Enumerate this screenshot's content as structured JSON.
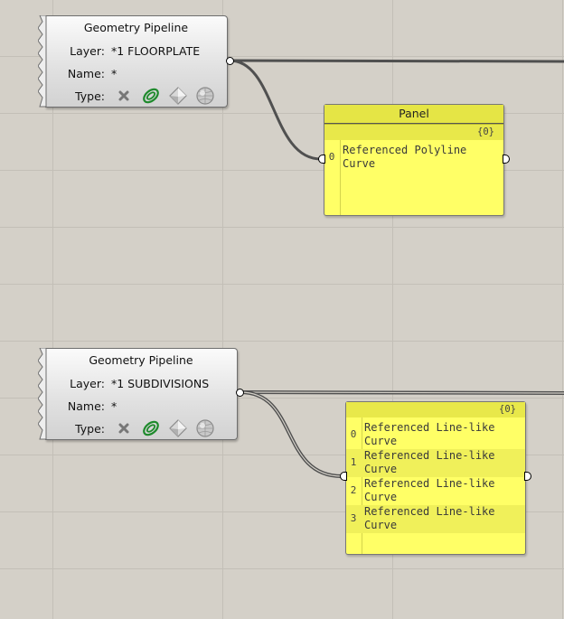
{
  "node1": {
    "title": "Geometry Pipeline",
    "layer_label": "Layer:",
    "layer_value": "*1 FLOORPLATE",
    "name_label": "Name:",
    "name_value": "*",
    "type_label": "Type:"
  },
  "panel1": {
    "title": "Panel",
    "branch": "{0}",
    "items": [
      {
        "index": "0",
        "line1": "Referenced Polyline",
        "line2": "Curve"
      }
    ]
  },
  "node2": {
    "title": "Geometry Pipeline",
    "layer_label": "Layer:",
    "layer_value": "*1 SUBDIVISIONS",
    "name_label": "Name:",
    "name_value": "*",
    "type_label": "Type:"
  },
  "panel2": {
    "branch": "{0}",
    "items": [
      {
        "index": "0",
        "line1": "Referenced Line-like",
        "line2": "Curve"
      },
      {
        "index": "1",
        "line1": "Referenced Line-like",
        "line2": "Curve"
      },
      {
        "index": "2",
        "line1": "Referenced Line-like",
        "line2": "Curve"
      },
      {
        "index": "3",
        "line1": "Referenced Line-like",
        "line2": "Curve"
      }
    ]
  },
  "type_icons": [
    "point-filter-icon",
    "curve-filter-icon",
    "surface-filter-icon",
    "mesh-filter-icon"
  ],
  "colors": {
    "canvas": "#d4d0c8",
    "panel": "#ffff66",
    "curve_icon": "#1e8a2c"
  }
}
